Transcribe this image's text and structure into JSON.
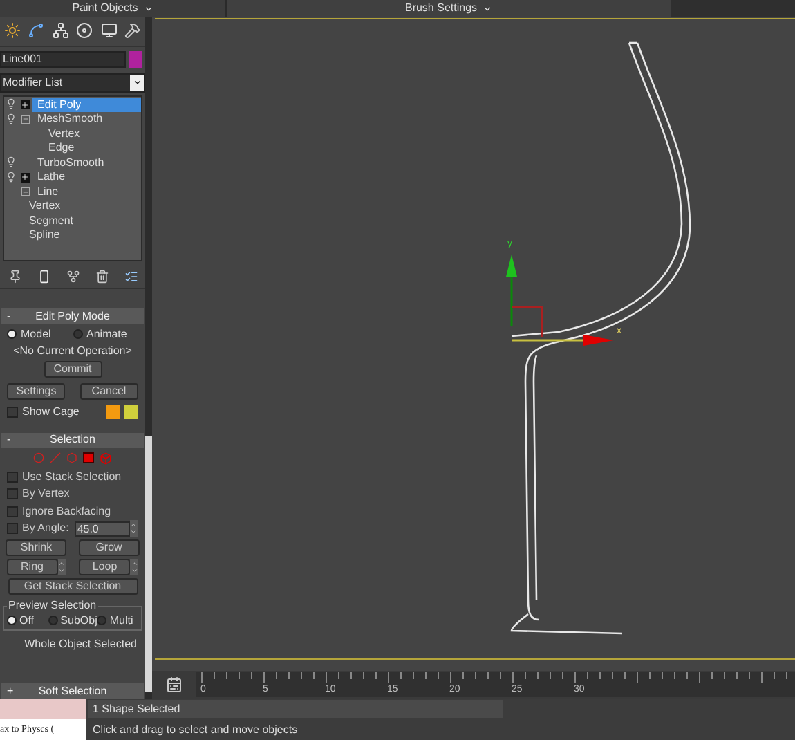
{
  "top_bar": {
    "left_menu": "Paint Objects",
    "center_menu": "Brush Settings"
  },
  "object_name": "Line001",
  "modifier_list": "Modifier List",
  "stack": [
    {
      "label": "Edit Poly",
      "selected": true,
      "bulb": true,
      "expanded": false
    },
    {
      "label": "MeshSmooth",
      "selected": false,
      "bulb": true,
      "expanded": true,
      "children": [
        {
          "label": "Vertex",
          "selected": false
        },
        {
          "label": "Edge",
          "selected": false
        }
      ]
    },
    {
      "label": "TurboSmooth",
      "selected": false,
      "bulb": true
    },
    {
      "label": "Lathe",
      "selected": false,
      "bulb": true,
      "expanded": false
    },
    {
      "label": "Line",
      "selected": false,
      "bulb": false,
      "expanded": true,
      "children": [
        {
          "label": "Vertex",
          "selected": false
        },
        {
          "label": "Segment",
          "selected": false
        },
        {
          "label": "Spline",
          "selected": false
        }
      ]
    }
  ],
  "edit_poly_mode": {
    "collapse": "-",
    "title": "Edit Poly Mode",
    "modes": [
      {
        "label": "Model",
        "selected": true
      },
      {
        "label": "Animate",
        "selected": false
      }
    ],
    "operation": "<No Current Operation>",
    "commit": "Commit",
    "settings": "Settings",
    "cancel": "Cancel",
    "show_cage": {
      "label": "Show Cage",
      "checked": false
    }
  },
  "selection": {
    "collapse": "-",
    "title": "Selection",
    "options": [
      {
        "label": "Use Stack Selection",
        "checked": false
      },
      {
        "label": "By Vertex",
        "checked": false
      },
      {
        "label": "Ignore Backfacing",
        "checked": false
      },
      {
        "label": "By Angle:",
        "checked": false,
        "value": "45.0"
      }
    ],
    "shrink": "Shrink",
    "grow": "Grow",
    "ring": "Ring",
    "loop": "Loop",
    "get_stack": "Get Stack Selection",
    "preview": {
      "title": "Preview Selection",
      "options": [
        {
          "label": "Off",
          "selected": true
        },
        {
          "label": "SubObj",
          "selected": false
        },
        {
          "label": "Multi",
          "selected": false
        }
      ]
    },
    "status": "Whole Object Selected"
  },
  "soft_selection": {
    "collapse": "+",
    "title": "Soft Selection"
  },
  "viewport": {
    "y_axis_label": "y",
    "x_axis_label": "x"
  },
  "timeline": {
    "frame_labels": [
      "0",
      "5",
      "10",
      "15",
      "20",
      "25",
      "30"
    ]
  },
  "maxscript": {
    "line": "ax to Physcs ("
  },
  "status_bar": {
    "selection": "1 Shape Selected",
    "prompt": "Click and drag to select and move objects"
  }
}
